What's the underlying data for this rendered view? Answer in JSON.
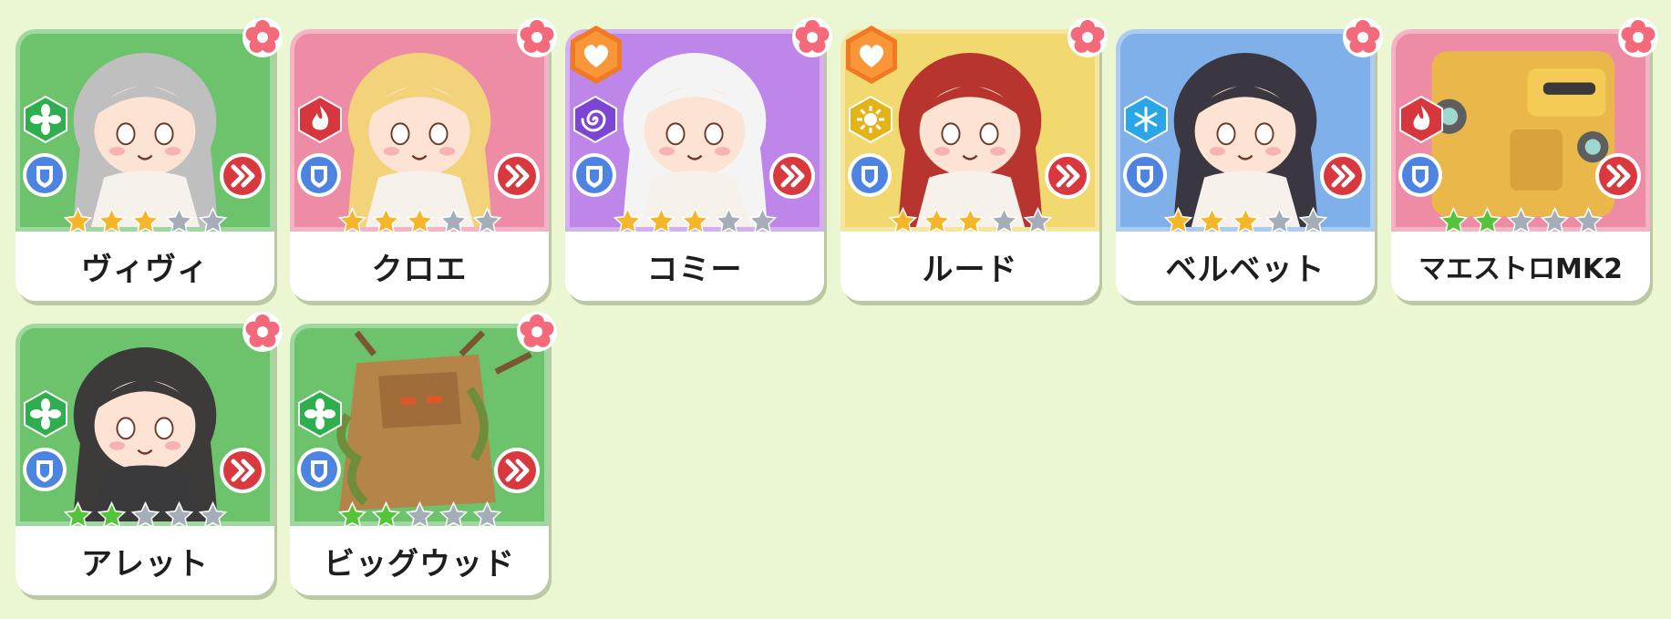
{
  "colors": {
    "background": "#ebf6d3",
    "green": "#6cc36c",
    "pink": "#ee8ca6",
    "purple": "#bf86ea",
    "yellow": "#f1d86f",
    "blue": "#7fb0ea",
    "star_gold": "#f6b62a",
    "star_green": "#55c43b",
    "star_empty": "#a4adb8"
  },
  "cards": [
    {
      "name": "ヴィヴィ",
      "bg": "#6cc36c",
      "element": "leaf-icon",
      "element_color": "#2fae4f",
      "stars": 3,
      "star_color": "gold",
      "like": false,
      "role": "shield-icon"
    },
    {
      "name": "クロエ",
      "bg": "#ee8ca6",
      "element": "fire-icon",
      "element_color": "#d8363d",
      "stars": 3,
      "star_color": "gold",
      "like": false,
      "role": "shield-icon"
    },
    {
      "name": "コミー",
      "bg": "#bf86ea",
      "element": "spiral-icon",
      "element_color": "#7c45d4",
      "stars": 3,
      "star_color": "gold",
      "like": true,
      "role": "shield-icon"
    },
    {
      "name": "ルード",
      "bg": "#f1d86f",
      "element": "sun-icon",
      "element_color": "#e3b317",
      "stars": 3,
      "star_color": "gold",
      "like": true,
      "role": "shield-icon"
    },
    {
      "name": "ベルベット",
      "bg": "#7fb0ea",
      "element": "snowflake-icon",
      "element_color": "#2aa6e8",
      "stars": 3,
      "star_color": "gold",
      "like": false,
      "role": "shield-icon"
    },
    {
      "name": "マエストロMK2",
      "bg": "#ee8ca6",
      "element": "fire-icon",
      "element_color": "#d8363d",
      "stars": 2,
      "star_color": "green",
      "like": false,
      "role": "shield-icon"
    },
    {
      "name": "アレット",
      "bg": "#6cc36c",
      "element": "leaf-icon",
      "element_color": "#2fae4f",
      "stars": 2,
      "star_color": "green",
      "like": false,
      "role": "shield-icon"
    },
    {
      "name": "ビッグウッド",
      "bg": "#6cc36c",
      "element": "leaf-icon",
      "element_color": "#2fae4f",
      "stars": 2,
      "star_color": "green",
      "like": false,
      "role": "shield-icon"
    }
  ]
}
